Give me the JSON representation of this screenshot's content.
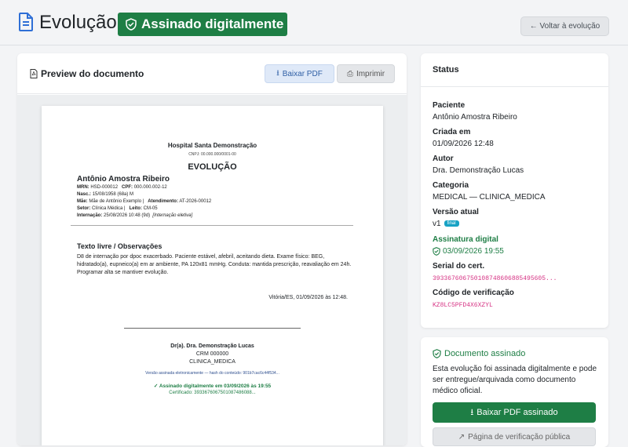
{
  "header": {
    "title": "Evolução",
    "signed_badge": "Assinado digitalmente",
    "back_button": "← Voltar à evolução"
  },
  "preview": {
    "title": "Preview do documento",
    "download_button": "Baixar PDF",
    "print_button": "Imprimir"
  },
  "document": {
    "hospital": "Hospital Santa Demonstração",
    "cnpj": "CNPJ: 00.000.000/0001-00",
    "heading": "EVOLUÇÃO",
    "patient": "Antônio Amostra Ribeiro",
    "mrn_label": "MRN:",
    "mrn": "HSD-000012",
    "cpf_label": "CPF:",
    "cpf": "000.000.002-12",
    "nasc_label": "Nasc.:",
    "nasc": "15/08/1958 (68a) M",
    "mae_label": "Mãe:",
    "mae": "Mãe de Antônio Exemplo |",
    "atend_label": "Atendimento:",
    "atend": "AT-2026-00012",
    "setor_label": "Setor:",
    "setor": "Clínica Médica |",
    "leito_label": "Leito:",
    "leito": "CM-05",
    "internacao_label": "Internação:",
    "internacao": "25/08/2026 10:48 (9d)",
    "internacao_note": "[Internação eletiva]",
    "section": "Texto livre / Observações",
    "body": "D8 de internação por dpoc exacerbado. Paciente estável, afebril, aceitando dieta. Exame físico: BEG, hidratado(a), eupneico(a) em ar ambiente, PA 120x81 mmHg. Conduta: mantida prescrição, reavaliação em 24h. Programar alta se mantiver evolução.",
    "date_line": "Vitória/ES, 01/09/2026 às 12:48.",
    "signer": "Dr(a). Dra. Demonstração Lucas",
    "crm": "CRM 000000",
    "specialty": "CLINICA_MEDICA",
    "hash_line": "Versão assinada eletronicamente — hash do conteúdo: 901b7cac6c44f534...",
    "signed_line": "✓ Assinado digitalmente em 03/09/2026 às 19:55",
    "cert_line": "Certificado: 3933676067501087486088..."
  },
  "status": {
    "title": "Status",
    "paciente_label": "Paciente",
    "paciente": "Antônio Amostra Ribeiro",
    "criada_label": "Criada em",
    "criada": "01/09/2026 12:48",
    "autor_label": "Autor",
    "autor": "Dra. Demonstração Lucas",
    "categoria_label": "Categoria",
    "categoria": "MEDICAL — CLINICA_MEDICA",
    "versao_label": "Versão atual",
    "versao": "v1",
    "versao_badge": "final",
    "assinatura_label": "Assinatura digital",
    "assinatura": "03/09/2026 19:55",
    "serial_label": "Serial do cert.",
    "serial": "393367606750108748606885495605...",
    "codigo_label": "Código de verificação",
    "codigo": "KZ8LC5PFD4X6XZYL"
  },
  "signed_card": {
    "title": "Documento assinado",
    "text": "Esta evolução foi assinada digitalmente e pode ser entregue/arquivada como documento médico oficial.",
    "download_button": "Baixar PDF assinado",
    "verify_button": "Página de verificação pública"
  },
  "colors": {
    "accent": "#1e7e45",
    "link": "#2f5fa5",
    "serial": "#d63384"
  }
}
